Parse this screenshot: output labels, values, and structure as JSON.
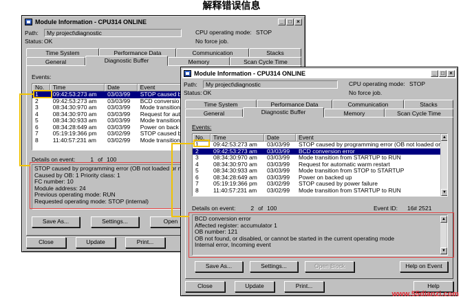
{
  "caption": "解释错误信息",
  "watermark": "www.55dianzi.com",
  "back_window": {
    "title": "Module Information - CPU314  ONLINE",
    "path_label": "Path:",
    "path_value": "My project\\diagnostic",
    "cpu_mode_label": "CPU operating mode:",
    "cpu_mode_value": "STOP",
    "status_label": "Status:",
    "status_value": "OK",
    "force_text": "No force job.",
    "tabs_row1": [
      "Time System",
      "Performance Data",
      "Communication",
      "Stacks"
    ],
    "tabs_row2": [
      "General",
      "Diagnostic Buffer",
      "Memory",
      "Scan Cycle Time"
    ],
    "events_label": "Events:",
    "columns": [
      "No.",
      "Time",
      "Date",
      "Event"
    ],
    "rows": [
      [
        "1",
        "09:42:53:273 am",
        "03/03/99",
        "STOP caused b"
      ],
      [
        "2",
        "09:42:53:273 am",
        "03/03/99",
        "BCD conversio"
      ],
      [
        "3",
        "08:34:30:970 am",
        "03/03/99",
        "Mode transition"
      ],
      [
        "4",
        "08:34:30:970 am",
        "03/03/99",
        "Request for aut"
      ],
      [
        "5",
        "08:34:30:933 am",
        "03/03/99",
        "Mode transition"
      ],
      [
        "6",
        "08:34:28:649 am",
        "03/03/99",
        "Power on back"
      ],
      [
        "7",
        "05:19:19:366 pm",
        "03/02/99",
        "STOP caused b"
      ],
      [
        "8",
        "11:40:57:231 am",
        "03/02/99",
        "Mode transition"
      ]
    ],
    "details_label": "Details on event:",
    "details_num": "1",
    "details_of": "of",
    "details_total": "100",
    "details_lines": [
      "STOP caused by programming error (OB not loaded or n",
      "Caused by OB:   1 Priority class:   1",
      "FC number:     10",
      "Module address:    24",
      "Previous operating mode: RUN",
      "Requested operating mode: STOP (internal)"
    ],
    "btn_save": "Save As...",
    "btn_settings": "Settings...",
    "btn_open": "Open",
    "btn_close": "Close",
    "btn_update": "Update",
    "btn_print": "Print..."
  },
  "front_window": {
    "title": "Module Information - CPU314  ONLINE",
    "path_label": "Path:",
    "path_value": "My project\\diagnostic",
    "cpu_mode_label": "CPU operating mode:",
    "cpu_mode_value": "STOP",
    "status_label": "Status:",
    "status_value": "OK",
    "force_text": "No force job.",
    "tabs_row1": [
      "Time System",
      "Performance Data",
      "Communication",
      "Stacks"
    ],
    "tabs_row2": [
      "General",
      "Diagnostic Buffer",
      "Memory",
      "Scan Cycle Time"
    ],
    "events_label": "Events:",
    "columns": [
      "No.",
      "Time",
      "Date",
      "Event"
    ],
    "rows": [
      [
        "1",
        "09:42:53:273 am",
        "03/03/99",
        "STOP caused by programming error (OB not loaded or n..."
      ],
      [
        "2",
        "09:42:53:273 am",
        "03/03/99",
        "BCD conversion error"
      ],
      [
        "3",
        "08:34:30:970 am",
        "03/03/99",
        "Mode transition from STARTUP to RUN"
      ],
      [
        "4",
        "08:34:30:970 am",
        "03/03/99",
        "Request for automatic warm restart"
      ],
      [
        "5",
        "08:34:30:933 am",
        "03/03/99",
        "Mode transition from STOP to STARTUP"
      ],
      [
        "6",
        "08:34:28:649 am",
        "03/03/99",
        "Power on backed up"
      ],
      [
        "7",
        "05:19:19:366 pm",
        "03/02/99",
        "STOP caused by power failure"
      ],
      [
        "8",
        "11:40:57:231 am",
        "03/02/99",
        "Mode transition from STARTUP to RUN"
      ]
    ],
    "details_label": "Details on event:",
    "details_num": "2",
    "details_of": "of",
    "details_total": "100",
    "event_id_label": "Event ID:",
    "event_id_value": "16# 2521",
    "details_lines": [
      "BCD conversion error",
      "Affected register: accumulator 1",
      "OB number: 121",
      "OB not found, or disabled, or cannot be started in the current operating mode",
      "Internal error, Incoming event"
    ],
    "btn_save": "Save As...",
    "btn_settings": "Settings...",
    "btn_open_block": "Open Block",
    "btn_help_event": "Help on Event",
    "btn_close": "Close",
    "btn_update": "Update",
    "btn_print": "Print...",
    "btn_help": "Help"
  },
  "colors": {
    "highlight_yellow": "#f2c300",
    "highlight_red": "#e04040",
    "selection": "#000080"
  }
}
